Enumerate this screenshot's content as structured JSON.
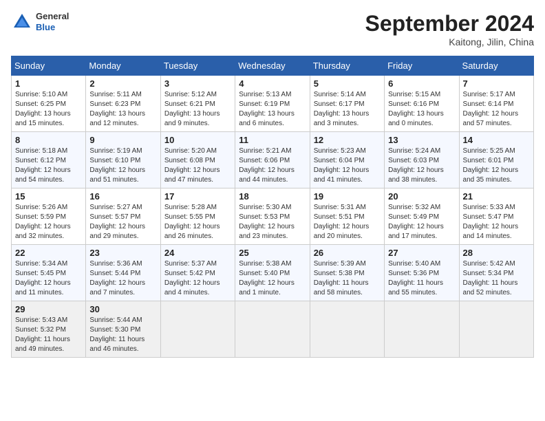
{
  "header": {
    "logo_general": "General",
    "logo_blue": "Blue",
    "month_title": "September 2024",
    "location": "Kaitong, Jilin, China"
  },
  "days_of_week": [
    "Sunday",
    "Monday",
    "Tuesday",
    "Wednesday",
    "Thursday",
    "Friday",
    "Saturday"
  ],
  "weeks": [
    [
      {
        "day": "1",
        "info": "Sunrise: 5:10 AM\nSunset: 6:25 PM\nDaylight: 13 hours\nand 15 minutes."
      },
      {
        "day": "2",
        "info": "Sunrise: 5:11 AM\nSunset: 6:23 PM\nDaylight: 13 hours\nand 12 minutes."
      },
      {
        "day": "3",
        "info": "Sunrise: 5:12 AM\nSunset: 6:21 PM\nDaylight: 13 hours\nand 9 minutes."
      },
      {
        "day": "4",
        "info": "Sunrise: 5:13 AM\nSunset: 6:19 PM\nDaylight: 13 hours\nand 6 minutes."
      },
      {
        "day": "5",
        "info": "Sunrise: 5:14 AM\nSunset: 6:17 PM\nDaylight: 13 hours\nand 3 minutes."
      },
      {
        "day": "6",
        "info": "Sunrise: 5:15 AM\nSunset: 6:16 PM\nDaylight: 13 hours\nand 0 minutes."
      },
      {
        "day": "7",
        "info": "Sunrise: 5:17 AM\nSunset: 6:14 PM\nDaylight: 12 hours\nand 57 minutes."
      }
    ],
    [
      {
        "day": "8",
        "info": "Sunrise: 5:18 AM\nSunset: 6:12 PM\nDaylight: 12 hours\nand 54 minutes."
      },
      {
        "day": "9",
        "info": "Sunrise: 5:19 AM\nSunset: 6:10 PM\nDaylight: 12 hours\nand 51 minutes."
      },
      {
        "day": "10",
        "info": "Sunrise: 5:20 AM\nSunset: 6:08 PM\nDaylight: 12 hours\nand 47 minutes."
      },
      {
        "day": "11",
        "info": "Sunrise: 5:21 AM\nSunset: 6:06 PM\nDaylight: 12 hours\nand 44 minutes."
      },
      {
        "day": "12",
        "info": "Sunrise: 5:23 AM\nSunset: 6:04 PM\nDaylight: 12 hours\nand 41 minutes."
      },
      {
        "day": "13",
        "info": "Sunrise: 5:24 AM\nSunset: 6:03 PM\nDaylight: 12 hours\nand 38 minutes."
      },
      {
        "day": "14",
        "info": "Sunrise: 5:25 AM\nSunset: 6:01 PM\nDaylight: 12 hours\nand 35 minutes."
      }
    ],
    [
      {
        "day": "15",
        "info": "Sunrise: 5:26 AM\nSunset: 5:59 PM\nDaylight: 12 hours\nand 32 minutes."
      },
      {
        "day": "16",
        "info": "Sunrise: 5:27 AM\nSunset: 5:57 PM\nDaylight: 12 hours\nand 29 minutes."
      },
      {
        "day": "17",
        "info": "Sunrise: 5:28 AM\nSunset: 5:55 PM\nDaylight: 12 hours\nand 26 minutes."
      },
      {
        "day": "18",
        "info": "Sunrise: 5:30 AM\nSunset: 5:53 PM\nDaylight: 12 hours\nand 23 minutes."
      },
      {
        "day": "19",
        "info": "Sunrise: 5:31 AM\nSunset: 5:51 PM\nDaylight: 12 hours\nand 20 minutes."
      },
      {
        "day": "20",
        "info": "Sunrise: 5:32 AM\nSunset: 5:49 PM\nDaylight: 12 hours\nand 17 minutes."
      },
      {
        "day": "21",
        "info": "Sunrise: 5:33 AM\nSunset: 5:47 PM\nDaylight: 12 hours\nand 14 minutes."
      }
    ],
    [
      {
        "day": "22",
        "info": "Sunrise: 5:34 AM\nSunset: 5:45 PM\nDaylight: 12 hours\nand 11 minutes."
      },
      {
        "day": "23",
        "info": "Sunrise: 5:36 AM\nSunset: 5:44 PM\nDaylight: 12 hours\nand 7 minutes."
      },
      {
        "day": "24",
        "info": "Sunrise: 5:37 AM\nSunset: 5:42 PM\nDaylight: 12 hours\nand 4 minutes."
      },
      {
        "day": "25",
        "info": "Sunrise: 5:38 AM\nSunset: 5:40 PM\nDaylight: 12 hours\nand 1 minute."
      },
      {
        "day": "26",
        "info": "Sunrise: 5:39 AM\nSunset: 5:38 PM\nDaylight: 11 hours\nand 58 minutes."
      },
      {
        "day": "27",
        "info": "Sunrise: 5:40 AM\nSunset: 5:36 PM\nDaylight: 11 hours\nand 55 minutes."
      },
      {
        "day": "28",
        "info": "Sunrise: 5:42 AM\nSunset: 5:34 PM\nDaylight: 11 hours\nand 52 minutes."
      }
    ],
    [
      {
        "day": "29",
        "info": "Sunrise: 5:43 AM\nSunset: 5:32 PM\nDaylight: 11 hours\nand 49 minutes."
      },
      {
        "day": "30",
        "info": "Sunrise: 5:44 AM\nSunset: 5:30 PM\nDaylight: 11 hours\nand 46 minutes."
      },
      {
        "day": "",
        "info": ""
      },
      {
        "day": "",
        "info": ""
      },
      {
        "day": "",
        "info": ""
      },
      {
        "day": "",
        "info": ""
      },
      {
        "day": "",
        "info": ""
      }
    ]
  ]
}
